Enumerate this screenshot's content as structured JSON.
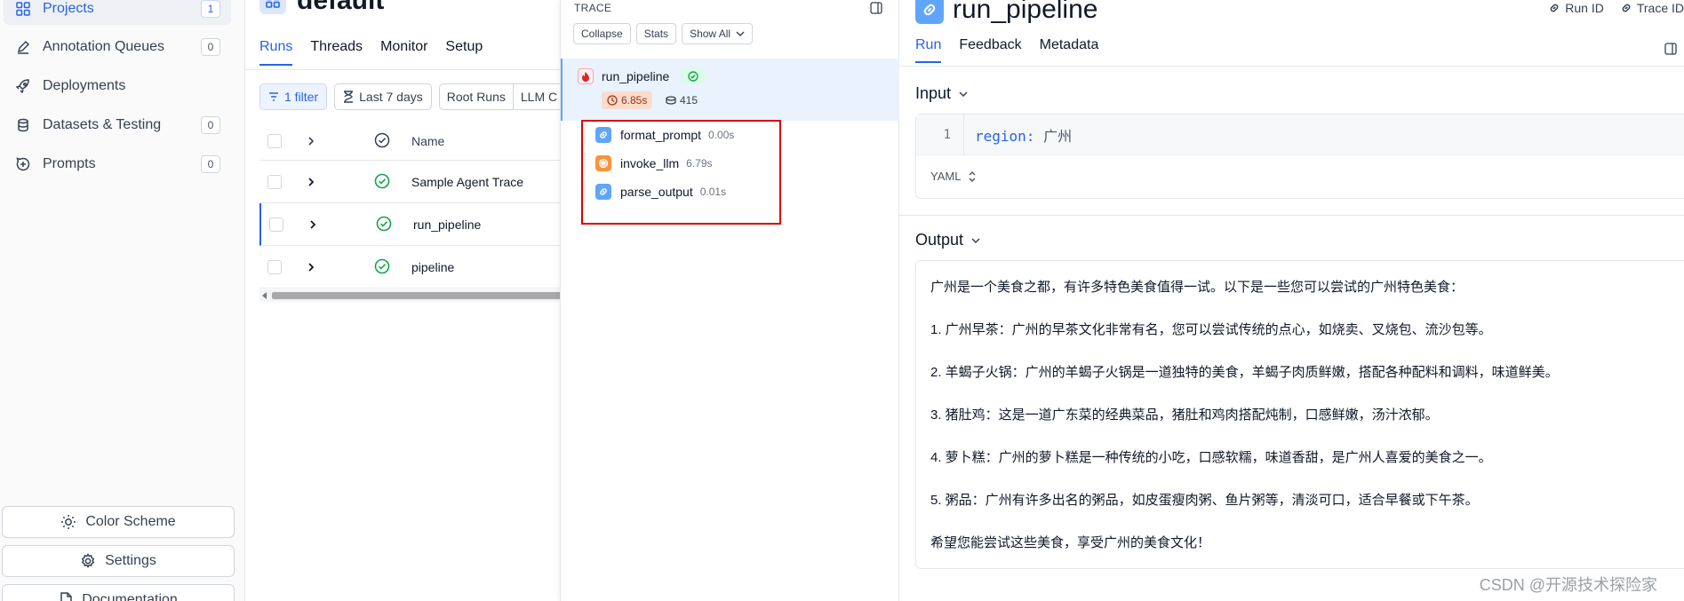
{
  "sidebar": {
    "items": [
      {
        "label": "Projects",
        "count": "1",
        "active": true
      },
      {
        "label": "Annotation Queues",
        "count": "0"
      },
      {
        "label": "Deployments",
        "count": ""
      },
      {
        "label": "Datasets & Testing",
        "count": "0"
      },
      {
        "label": "Prompts",
        "count": "0"
      }
    ],
    "color_scheme_label": "Color Scheme",
    "settings_label": "Settings",
    "documentation_label": "Documentation"
  },
  "project": {
    "title": "default",
    "tabs": [
      "Runs",
      "Threads",
      "Monitor",
      "Setup"
    ],
    "filters": {
      "filter_label": "1 filter",
      "date_label": "Last 7 days",
      "root_runs_label": "Root Runs",
      "llm_label": "LLM C"
    },
    "table": {
      "header_name": "Name",
      "rows": [
        "Sample Agent Trace",
        "run_pipeline",
        "pipeline"
      ]
    }
  },
  "trace": {
    "label": "TRACE",
    "buttons": {
      "collapse": "Collapse",
      "stats": "Stats",
      "show_all": "Show All"
    },
    "root": {
      "name": "run_pipeline",
      "latency": "6.85s",
      "tokens": "415"
    },
    "children": [
      {
        "name": "format_prompt",
        "time": "0.00s",
        "kind": "chain"
      },
      {
        "name": "invoke_llm",
        "time": "6.79s",
        "kind": "llm"
      },
      {
        "name": "parse_output",
        "time": "0.01s",
        "kind": "chain"
      }
    ]
  },
  "detail": {
    "title": "run_pipeline",
    "run_id_label": "Run ID",
    "trace_id_label": "Trace ID",
    "tabs": [
      "Run",
      "Feedback",
      "Metadata"
    ],
    "input_heading": "Input",
    "input_line_number": "1",
    "input_key": "region:",
    "input_value": "广州",
    "format_label": "YAML",
    "output_heading": "Output",
    "output_lines": [
      "广州是一个美食之都，有许多特色美食值得一试。以下是一些您可以尝试的广州特色美食：",
      "1. 广州早茶：广州的早茶文化非常有名，您可以尝试传统的点心，如烧卖、叉烧包、流沙包等。",
      "2. 羊蝎子火锅：广州的羊蝎子火锅是一道独特的美食，羊蝎子肉质鲜嫩，搭配各种配料和调料，味道鲜美。",
      "3. 猪肚鸡：这是一道广东菜的经典菜品，猪肚和鸡肉搭配炖制，口感鲜嫩，汤汁浓郁。",
      "4. 萝卜糕：广州的萝卜糕是一种传统的小吃，口感软糯，味道香甜，是广州人喜爱的美食之一。",
      "5. 粥品：广州有许多出名的粥品，如皮蛋瘦肉粥、鱼片粥等，清淡可口，适合早餐或下午茶。",
      "希望您能尝试这些美食，享受广州的美食文化！"
    ]
  },
  "watermark": "CSDN @开源技术探险家",
  "colors": {
    "accent": "#2563eb",
    "highlight_box": "#d90000",
    "chain_icon": "#60a5fa",
    "llm_icon": "#fb923c"
  }
}
